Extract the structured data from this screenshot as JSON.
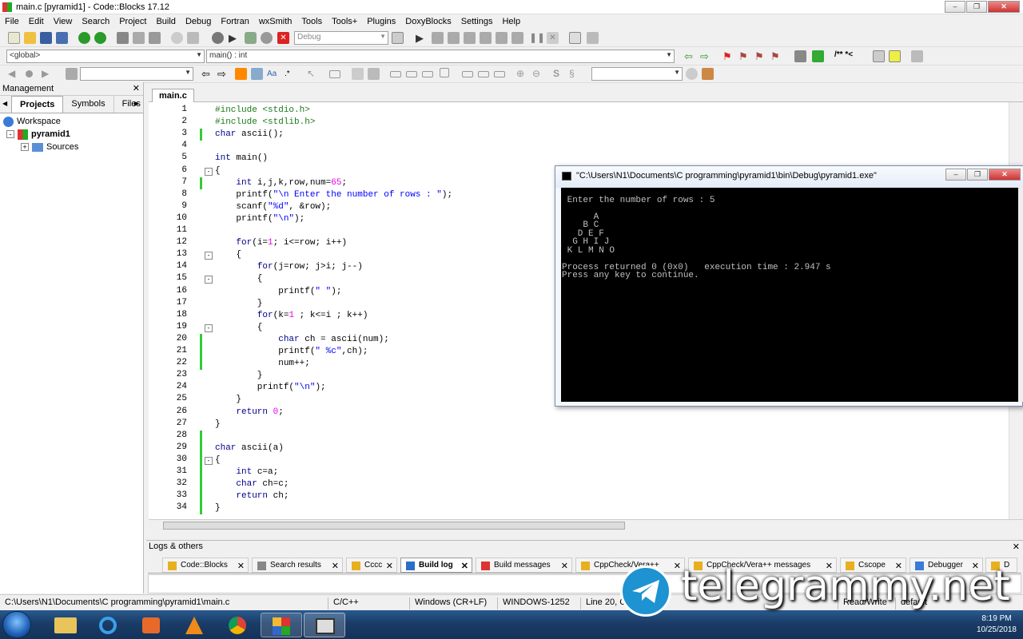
{
  "window": {
    "title": "main.c [pyramid1] - Code::Blocks 17.12"
  },
  "menu": [
    "File",
    "Edit",
    "View",
    "Search",
    "Project",
    "Build",
    "Debug",
    "Fortran",
    "wxSmith",
    "Tools",
    "Tools+",
    "Plugins",
    "DoxyBlocks",
    "Settings",
    "Help"
  ],
  "toolbar": {
    "build_target": "Debug",
    "scope": "<global>",
    "function": "main() : int"
  },
  "management": {
    "title": "Management",
    "tabs": [
      "Projects",
      "Symbols",
      "Files"
    ],
    "tree": {
      "workspace": "Workspace",
      "project": "pyramid1",
      "folder": "Sources"
    }
  },
  "editor": {
    "tab": "main.c",
    "lines": [
      "#include <stdio.h>",
      "#include <stdlib.h>",
      "char ascii();",
      "",
      "int main()",
      "{",
      "    int i,j,k,row,num=65;",
      "    printf(\"\\n Enter the number of rows : \");",
      "    scanf(\"%d\", &row);",
      "    printf(\"\\n\");",
      "",
      "    for(i=1; i<=row; i++)",
      "    {",
      "        for(j=row; j>i; j--)",
      "        {",
      "            printf(\" \");",
      "        }",
      "        for(k=1 ; k<=i ; k++)",
      "        {",
      "            char ch = ascii(num);",
      "            printf(\" %c\",ch);",
      "            num++;",
      "        }",
      "        printf(\"\\n\");",
      "    }",
      "    return 0;",
      "}",
      "",
      "char ascii(a)",
      "{",
      "    int c=a;",
      "    char ch=c;",
      "    return ch;",
      "}"
    ]
  },
  "console": {
    "title": "\"C:\\Users\\N1\\Documents\\C programming\\pyramid1\\bin\\Debug\\pyramid1.exe\"",
    "output": "\n Enter the number of rows : 5\n\n      A\n    B C\n   D E F\n  G H I J\n K L M N O\n\nProcess returned 0 (0x0)   execution time : 2.947 s\nPress any key to continue."
  },
  "logs": {
    "title": "Logs & others",
    "tabs": [
      "Code::Blocks",
      "Search results",
      "Cccc",
      "Build log",
      "Build messages",
      "CppCheck/Vera++",
      "CppCheck/Vera++ messages",
      "Cscope",
      "Debugger",
      "D"
    ]
  },
  "status": {
    "path": "C:\\Users\\N1\\Documents\\C programming\\pyramid1\\main.c",
    "lang": "C/C++",
    "eol": "Windows (CR+LF)",
    "encoding": "WINDOWS-1252",
    "pos": "Line 20, Co",
    "mode": "Read/Write",
    "profile": "default"
  },
  "taskbar": {
    "time": "8:19 PM",
    "date": "10/25/2018"
  },
  "watermark": "telegrammy.net"
}
